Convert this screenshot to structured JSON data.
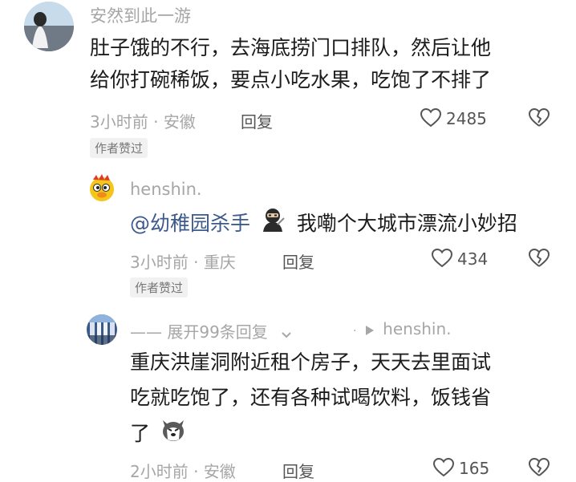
{
  "comments": [
    {
      "username": "安然到此一游",
      "text_line1": "肚子饿的不行，去海底捞门口排队，然后让他",
      "text_line2": "给你打碗稀饭，要点小吃水果，吃饱了不排了",
      "time": "3小时前",
      "sep": "·",
      "location": "安徽",
      "reply_label": "回复",
      "likes": "2485",
      "badge": "作者赞过"
    },
    {
      "username": "henshin.",
      "mention": "@幼稚园杀手",
      "text": "我嘞个大城市漂流小妙招",
      "time": "3小时前",
      "sep": "·",
      "location": "重庆",
      "reply_label": "回复",
      "likes": "434",
      "badge": "作者赞过"
    },
    {
      "expand_label": "—— 展开99条回复",
      "reply_to": "henshin.",
      "text_line1": "重庆洪崖洞附近租个房子，天天去里面试",
      "text_line2": "吃就吃饱了，还有各种试喝饮料，饭钱省",
      "text_line3": "了",
      "time": "2小时前",
      "sep": "·",
      "location": "安徽",
      "reply_label": "回复",
      "likes": "165"
    }
  ],
  "icons": {
    "like": "heart-outline-icon",
    "dislike": "broken-heart-icon",
    "expand": "chevron-down-icon",
    "reply_arrow": "play-arrow-icon"
  }
}
